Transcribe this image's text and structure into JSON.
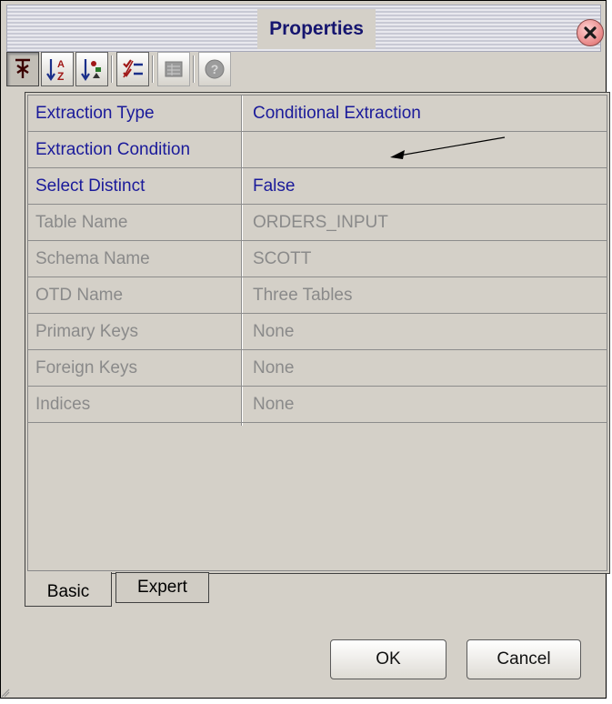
{
  "window": {
    "title": "Properties"
  },
  "toolbar": {
    "buttons": [
      {
        "icon": "categorized-icon",
        "state": "pressed"
      },
      {
        "icon": "sort-alphabetical-icon",
        "state": "normal"
      },
      {
        "icon": "sort-by-type-icon",
        "state": "normal"
      },
      {
        "icon": "show-editable-icon",
        "state": "normal"
      },
      {
        "icon": "customizer-icon",
        "state": "disabled"
      },
      {
        "icon": "help-icon",
        "state": "disabled"
      }
    ]
  },
  "properties": {
    "rows": [
      {
        "name": "Extraction Type",
        "value": "Conditional Extraction",
        "editable": true
      },
      {
        "name": "Extraction Condition",
        "value": "",
        "editable": true
      },
      {
        "name": "Select Distinct",
        "value": "False",
        "editable": true
      },
      {
        "name": "Table Name",
        "value": "ORDERS_INPUT",
        "editable": false
      },
      {
        "name": "Schema Name",
        "value": "SCOTT",
        "editable": false
      },
      {
        "name": "OTD Name",
        "value": "Three Tables",
        "editable": false
      },
      {
        "name": "Primary Keys",
        "value": "None",
        "editable": false
      },
      {
        "name": "Foreign Keys",
        "value": "None",
        "editable": false
      },
      {
        "name": "Indices",
        "value": "None",
        "editable": false
      }
    ]
  },
  "tabs": {
    "basic": "Basic",
    "expert": "Expert",
    "active": "Basic"
  },
  "buttons": {
    "ok": "OK",
    "cancel": "Cancel"
  },
  "colors": {
    "editable_text": "#1a1a9a",
    "readonly_text": "#8a8a8a",
    "title_text": "#15156f",
    "window_bg": "#d4d0c8"
  }
}
